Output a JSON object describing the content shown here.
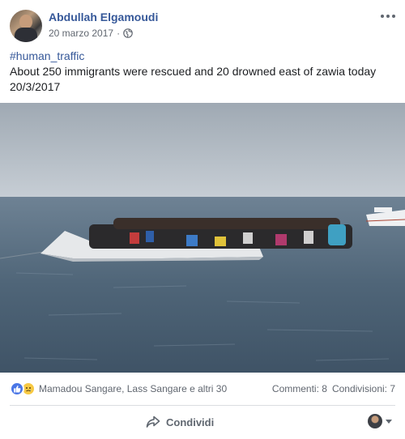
{
  "post": {
    "author": "Abdullah Elgamoudi",
    "date": "20 marzo 2017",
    "separator": "·",
    "privacy_icon": "globe-icon",
    "more_icon": "more-options-icon",
    "hashtag": "#human_traffic",
    "body": "About 250 immigrants were rescued and 20 drowned east of zawia today 20/3/2017",
    "image_icon": "photo"
  },
  "reactions": {
    "icons": [
      "like-icon",
      "sad-icon"
    ],
    "names": "Mamadou Sangare, Lass Sangare e altri 30",
    "comments": "Commenti: 8",
    "shares": "Condivisioni: 7"
  },
  "actions": {
    "share_label": "Condividi",
    "share_icon": "share-arrow-icon",
    "viewer_icon": "viewer-avatar",
    "dropdown_icon": "chevron-down-icon"
  },
  "colors": {
    "link": "#365899",
    "text": "#1c1e21",
    "muted": "#616770",
    "like": "#4a76e6",
    "sad": "#f7c944"
  }
}
